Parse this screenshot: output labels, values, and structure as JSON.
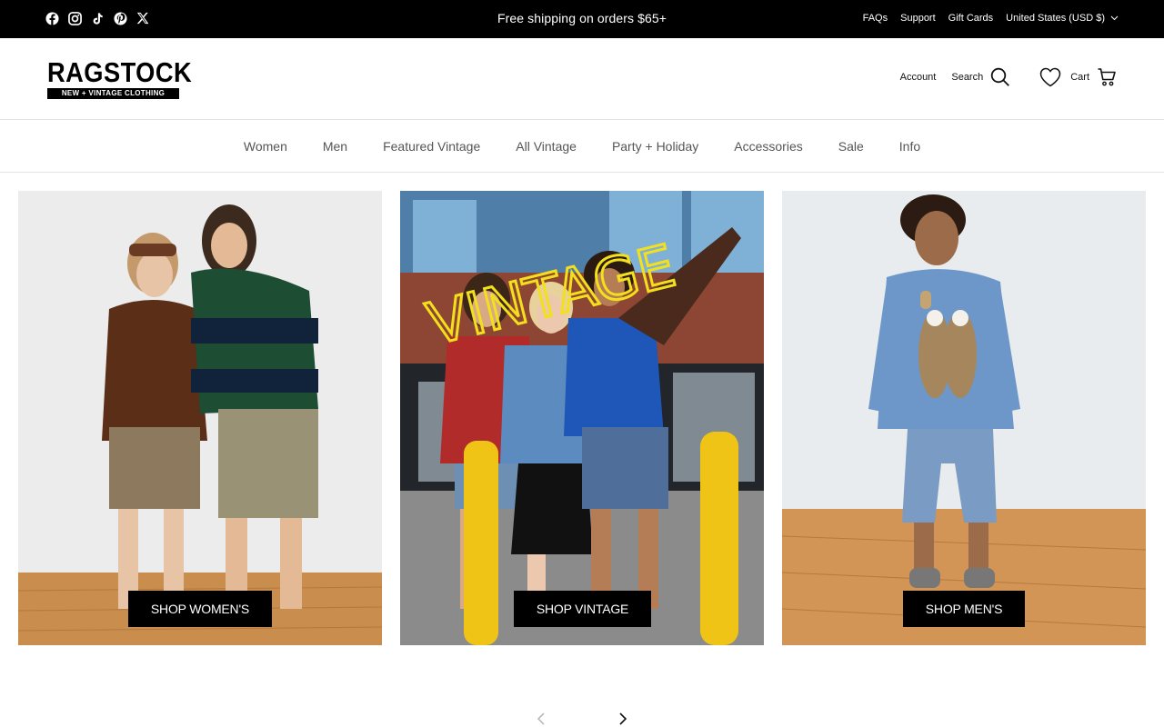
{
  "announcement": {
    "text": "Free shipping on orders $65+",
    "social_icons": [
      "facebook-icon",
      "instagram-icon",
      "tiktok-icon",
      "pinterest-icon",
      "x-icon"
    ],
    "links": [
      "FAQs",
      "Support",
      "Gift Cards"
    ],
    "currency": "United States (USD $)"
  },
  "header": {
    "logo_word": "RAGSTOCK",
    "logo_tagline": "NEW + VINTAGE CLOTHING",
    "account": "Account",
    "search": "Search",
    "cart": "Cart"
  },
  "nav": {
    "items": [
      "Women",
      "Men",
      "Featured Vintage",
      "All Vintage",
      "Party + Holiday",
      "Accessories",
      "Sale",
      "Info"
    ]
  },
  "tiles": [
    {
      "button": "SHOP WOMEN'S"
    },
    {
      "overlay_text": "VINTAGE",
      "button": "SHOP VINTAGE"
    },
    {
      "button": "SHOP MEN'S"
    }
  ],
  "colors": {
    "bar": "#000000",
    "accent_yellow": "#f3e01c",
    "floor": "#c98d4e"
  }
}
